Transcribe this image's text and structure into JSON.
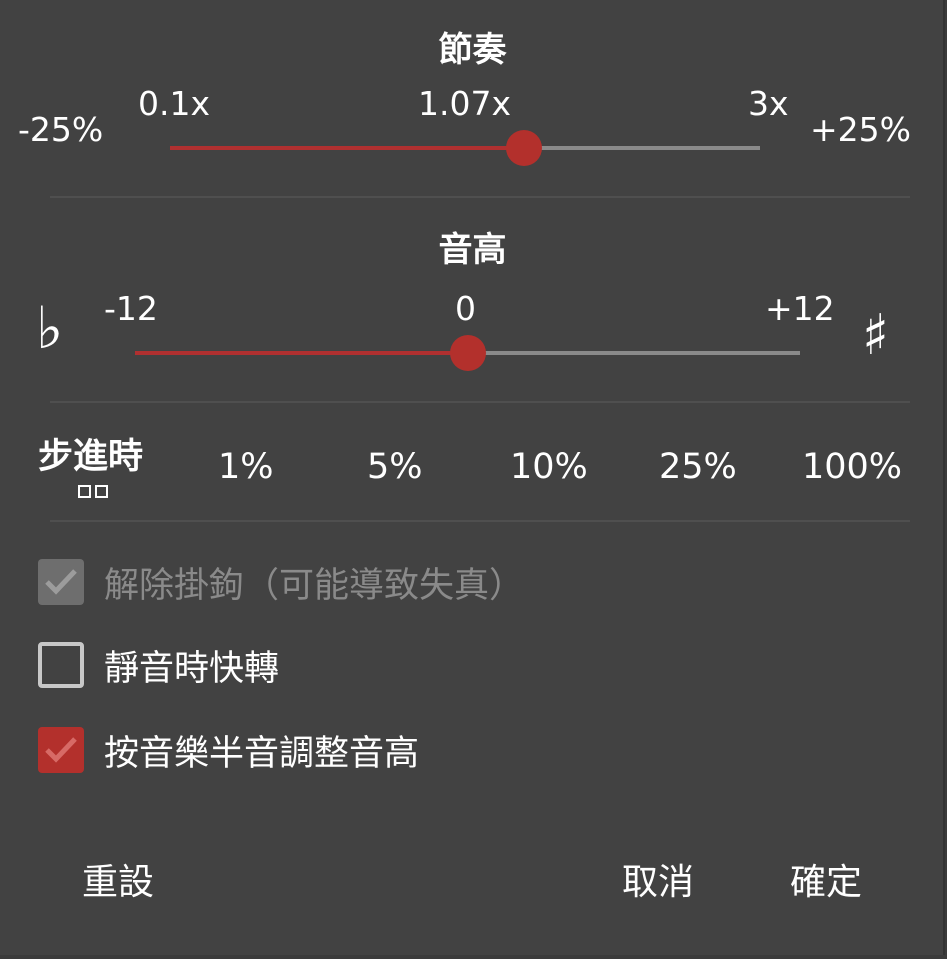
{
  "tempo": {
    "title": "節奏",
    "left_label": "-25%",
    "right_label": "+25%",
    "min_label": "0.1x",
    "current_label": "1.07x",
    "max_label": "3x",
    "position_fraction": 0.6
  },
  "pitch": {
    "title": "音高",
    "flat_symbol": "♭",
    "sharp_symbol": "♯",
    "min_label": "-12",
    "current_label": "0",
    "max_label": "+12",
    "position_fraction": 0.5
  },
  "step": {
    "title": "步進時",
    "options": [
      "1%",
      "5%",
      "10%",
      "25%",
      "100%"
    ]
  },
  "checkboxes": {
    "unhook": {
      "label": "解除掛鉤（可能導致失真）",
      "checked": true,
      "enabled": false
    },
    "fast_forward_silence": {
      "label": "靜音時快轉",
      "checked": false,
      "enabled": true
    },
    "semitone_pitch": {
      "label": "按音樂半音調整音高",
      "checked": true,
      "enabled": true
    }
  },
  "buttons": {
    "reset": "重設",
    "cancel": "取消",
    "ok": "確定"
  },
  "colors": {
    "accent": "#b3302c",
    "background": "#424242",
    "track": "#8a8a8a",
    "disabled_text": "#8a8a8a"
  }
}
